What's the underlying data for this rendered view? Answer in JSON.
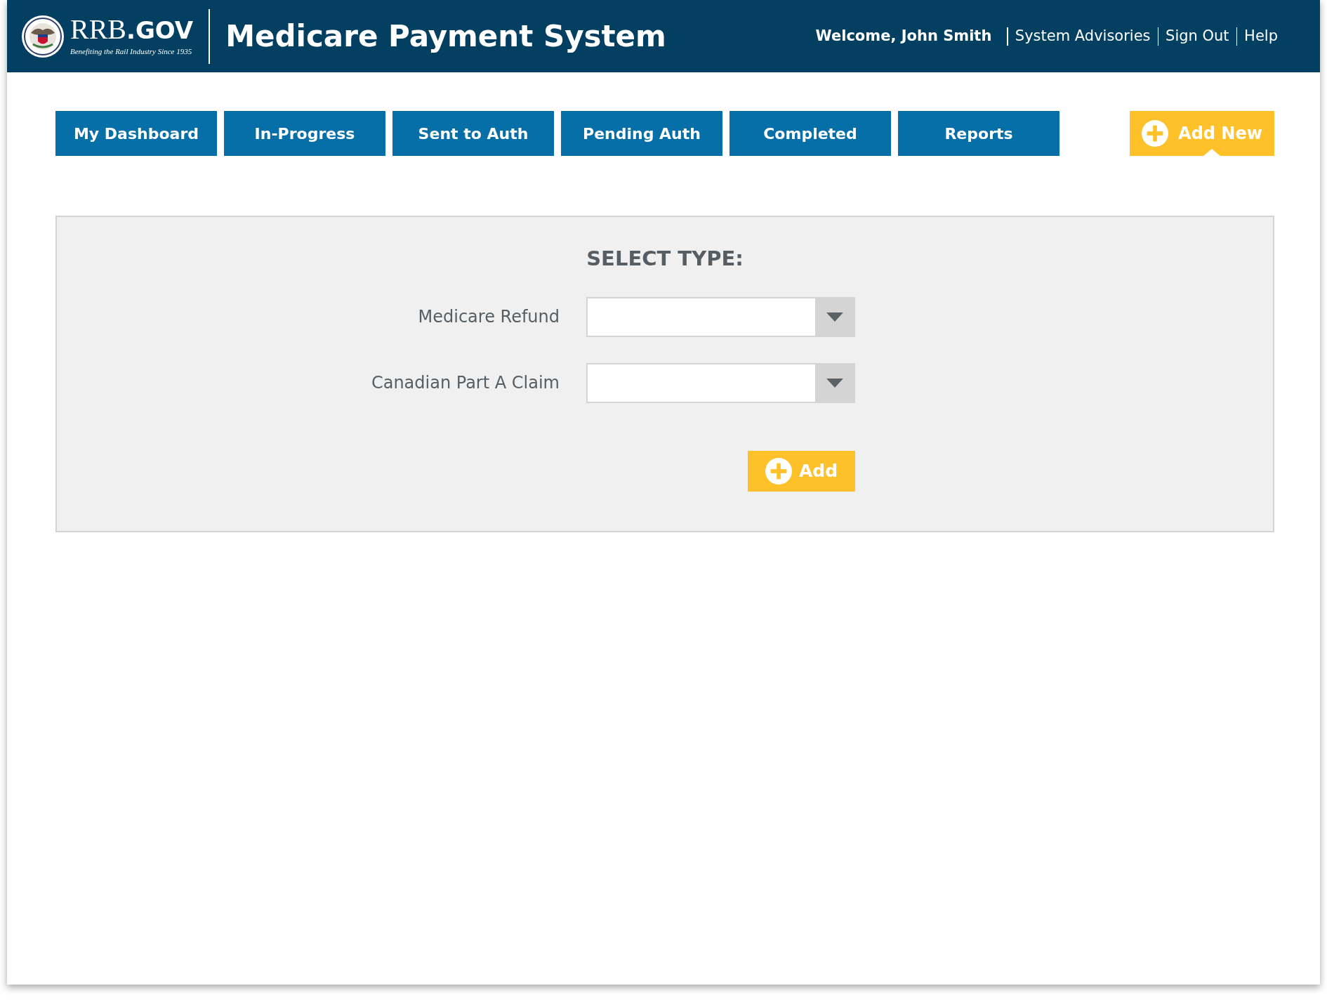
{
  "header": {
    "logo": {
      "name": "RRB",
      "domain": ".GOV",
      "tagline": "Benefiting the Rail Industry Since 1935"
    },
    "title": "Medicare Payment System",
    "welcome": "Welcome, John Smith",
    "links": [
      "System Advisories",
      "Sign Out",
      "Help"
    ]
  },
  "nav": {
    "tabs": [
      {
        "label": "My Dashboard",
        "selected": false
      },
      {
        "label": "In-Progress",
        "selected": false
      },
      {
        "label": "Sent to Auth",
        "selected": false
      },
      {
        "label": "Pending Auth",
        "selected": false
      },
      {
        "label": "Completed",
        "selected": false
      },
      {
        "label": "Reports",
        "selected": false
      }
    ],
    "add_new": {
      "label": "Add New",
      "selected": true
    }
  },
  "panel": {
    "heading": "SELECT TYPE:",
    "fields": [
      {
        "label": "Medicare Refund"
      },
      {
        "label": "Canadian Part A Claim"
      }
    ],
    "button": "Add"
  }
}
